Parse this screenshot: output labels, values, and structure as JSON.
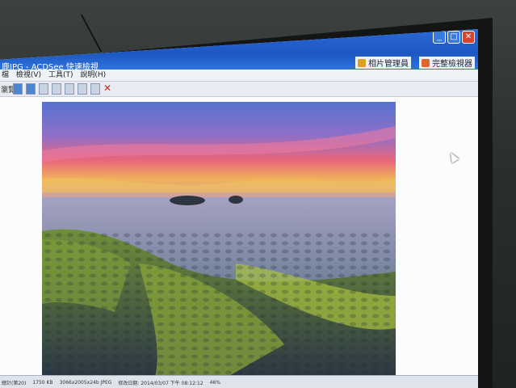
{
  "window": {
    "title": "鹿JPG - ACDSee 快速檢視",
    "buttons": {
      "minimize": "_",
      "maximize": "□",
      "close": "✕"
    }
  },
  "header_tools": [
    {
      "label": "相片管理員",
      "icon": "photo-manager-icon",
      "color": "#d8a21c"
    },
    {
      "label": "完整檢視器",
      "icon": "full-viewer-icon",
      "color": "#e0662a"
    }
  ],
  "menu": [
    "檔",
    "檢視(V)",
    "工具(T)",
    "說明(H)"
  ],
  "toolbar": {
    "label": "瀏覽"
  },
  "photo": {
    "description_icon": "seascape-photo",
    "colors": {
      "sky_top": "#5d7fd6",
      "sunset_pink": "#e8667c",
      "sunset_yellow": "#e8c04a",
      "sea": "#8f90b0",
      "rock_moss": "#9fb83a",
      "rock_dark": "#2f3d49"
    }
  },
  "statusbar": {
    "items": [
      "總計(第20)",
      "1750 KB",
      "3066x2005x24b JPEG",
      "修改日期: 2014/03/07 下午 08:12:12",
      "46%"
    ]
  }
}
